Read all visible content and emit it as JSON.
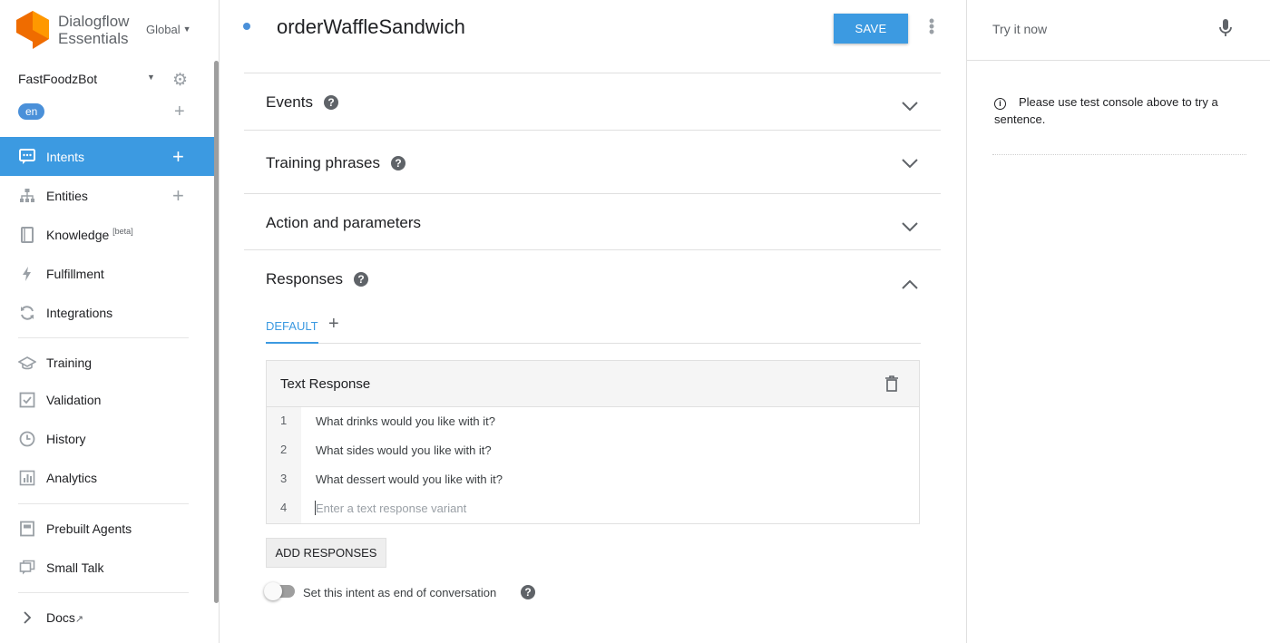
{
  "brand": {
    "line1": "Dialogflow",
    "line2": "Essentials",
    "region": "Global",
    "logo_color": "#F57C00"
  },
  "agent": {
    "name": "FastFoodzBot",
    "language": "en"
  },
  "nav": {
    "intents": "Intents",
    "entities": "Entities",
    "knowledge": "Knowledge",
    "knowledge_badge": "[beta]",
    "fulfillment": "Fulfillment",
    "integrations": "Integrations",
    "training": "Training",
    "validation": "Validation",
    "history": "History",
    "analytics": "Analytics",
    "prebuilt_agents": "Prebuilt Agents",
    "small_talk": "Small Talk",
    "docs": "Docs"
  },
  "intent": {
    "name": "orderWaffleSandwich",
    "save_label": "SAVE"
  },
  "sections": {
    "events": "Events",
    "training_phrases": "Training phrases",
    "action_parameters": "Action and parameters",
    "responses": "Responses"
  },
  "responses": {
    "tab_default": "DEFAULT",
    "card_title": "Text Response",
    "rows": [
      {
        "num": "1",
        "text": "What drinks would you like with it?"
      },
      {
        "num": "2",
        "text": "What sides would you like with it?"
      },
      {
        "num": "3",
        "text": "What dessert would you like with it?"
      },
      {
        "num": "4",
        "placeholder": "Enter a text response variant"
      }
    ],
    "add_label": "ADD RESPONSES",
    "end_conversation_label": "Set this intent as end of conversation",
    "end_conversation_enabled": false
  },
  "console": {
    "placeholder": "Try it now",
    "info_text": "Please use test console above to try a sentence."
  },
  "colors": {
    "accent": "#3C9AE1",
    "active_nav": "#3C9AE1"
  }
}
